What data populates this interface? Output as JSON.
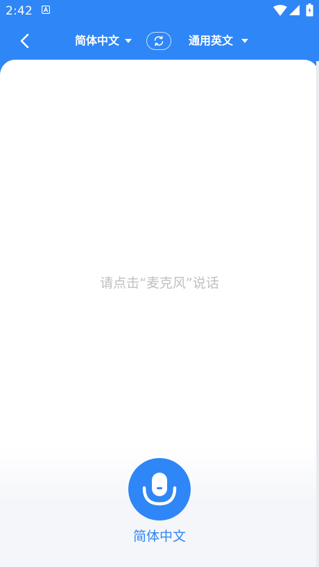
{
  "status_bar": {
    "time": "2:42",
    "notification_icon": "a-letter-icon",
    "icons": [
      "wifi-icon",
      "signal-icon",
      "battery-icon"
    ]
  },
  "header": {
    "back_icon": "chevron-left-icon",
    "source_language": "简体中文",
    "swap_icon": "swap-icon",
    "target_language": "通用英文",
    "dropdown_icon": "caret-down-icon"
  },
  "main": {
    "hint": "请点击“麦克风”说话",
    "mic_icon": "microphone-icon",
    "mic_label": "简体中文"
  },
  "colors": {
    "accent": "#2f86f6",
    "hint_text": "#bfbfbf",
    "bottom_panel": "#f5f6f9"
  }
}
